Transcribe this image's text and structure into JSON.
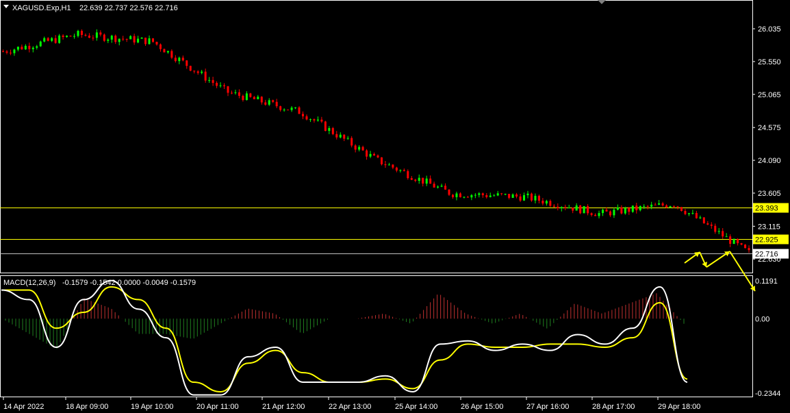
{
  "symbol_header": {
    "symbol": "XAGUSD.Exp,H1",
    "ohlc": "22.639 22.737 22.576 22.716"
  },
  "macd_header": {
    "label": "MACD(12,26,9)",
    "values": "-0.1579 -0.1542 0.0000 -0.0049 -0.1579"
  },
  "colors": {
    "background": "#000000",
    "bull_candle": "#00ff00",
    "bear_candle": "#ff0000",
    "level_line": "#ffff00",
    "current_line": "#c0c0c0",
    "macd_line": "#ffffff",
    "signal_line": "#ffff00",
    "hist_up": "#c03030",
    "hist_down": "#208020",
    "arrow": "#ffff00"
  },
  "chart_data": [
    {
      "type": "line",
      "title": "XAGUSD.Exp,H1",
      "series": [
        {
          "name": "",
          "x": [
            "14 Apr 2022",
            "18 Apr 09:00",
            "19 Apr 10:00",
            "20 Apr 11:00",
            "21 Apr 12:00",
            "22 Apr 13:00",
            "25 Apr 14:00",
            "26 Apr 15:00",
            "27 Apr 16:00",
            "28 Apr 17:00",
            "29 Apr 18:00"
          ],
          "values": [
            25.7,
            25.95,
            25.85,
            25.1,
            24.8,
            24.1,
            23.6,
            23.55,
            23.3,
            23.45,
            22.72
          ]
        }
      ],
      "y_ticks": [
        "26.035",
        "25.550",
        "25.065",
        "24.575",
        "24.090",
        "23.605",
        "23.115",
        "22.630"
      ],
      "ylim": [
        22.45,
        26.42
      ],
      "levels": [
        {
          "label": "23.393",
          "value": 23.393
        },
        {
          "label": "22.925",
          "value": 22.925
        }
      ],
      "current_price": {
        "label": "22.716",
        "value": 22.716
      },
      "x_ticks": [
        "14 Apr 2022",
        "18 Apr 09:00",
        "19 Apr 10:00",
        "20 Apr 11:00",
        "21 Apr 12:00",
        "22 Apr 13:00",
        "25 Apr 14:00",
        "26 Apr 15:00",
        "27 Apr 16:00",
        "28 Apr 17:00",
        "29 Apr 18:00"
      ]
    },
    {
      "type": "line",
      "title": "MACD(12,26,9)",
      "series": [
        {
          "name": "",
          "values": [
            0.09,
            0.06,
            -0.09,
            0.06,
            0.12,
            0.03,
            -0.06,
            -0.24,
            -0.24,
            -0.12,
            -0.09,
            -0.2,
            -0.2,
            -0.2,
            -0.18,
            -0.23,
            -0.08,
            -0.07,
            -0.1,
            -0.08,
            -0.1,
            -0.05,
            -0.08,
            -0.03,
            0.1,
            -0.2
          ]
        },
        {
          "name": "",
          "values": [
            0.09,
            0.09,
            -0.03,
            0.02,
            0.1,
            0.06,
            -0.03,
            -0.2,
            -0.23,
            -0.14,
            -0.1,
            -0.17,
            -0.2,
            -0.2,
            -0.19,
            -0.22,
            -0.13,
            -0.08,
            -0.09,
            -0.09,
            -0.08,
            -0.08,
            -0.09,
            -0.06,
            0.05,
            -0.19
          ]
        }
      ],
      "y_ticks": [
        "0.1191",
        "0.00",
        "-0.2344"
      ],
      "ylim": [
        -0.2344,
        0.1191
      ]
    }
  ]
}
